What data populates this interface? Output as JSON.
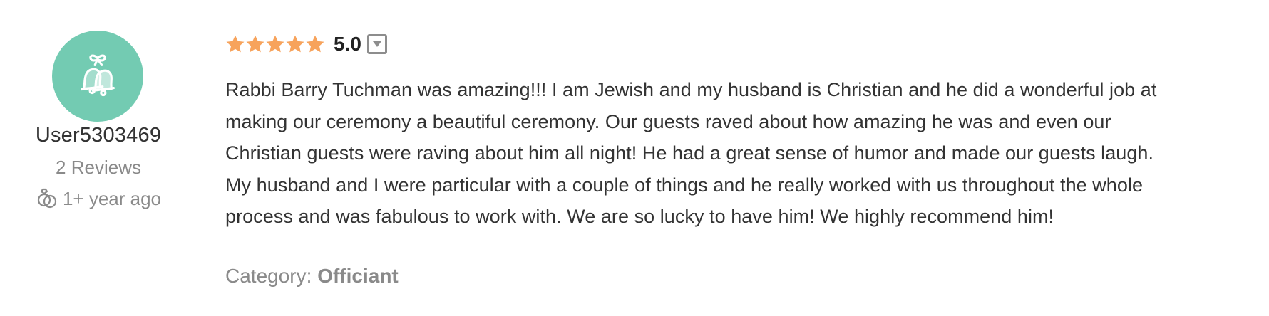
{
  "author": {
    "username": "User5303469",
    "reviews": "2 Reviews",
    "date": "1+ year ago",
    "avatar_icon": "wedding-bells-icon",
    "date_icon": "wedding-rings-icon",
    "avatar_color": "#73cbb2"
  },
  "rating": {
    "value": "5.0",
    "stars": 5,
    "max_stars": 5,
    "star_color": "#f7a35c",
    "toggle_icon": "dropdown-toggle-icon"
  },
  "review": {
    "lines": [
      "Rabbi Barry Tuchman was amazing!!! I am Jewish and my husband is Christian and he did a wonderful job at",
      "making our ceremony a beautiful ceremony. Our guests raved about how amazing he was and even our",
      "Christian guests were raving about him all night! He had a great sense of humor and made our guests laugh.",
      "My husband and I were particular with a couple of things and he really worked with us throughout the whole",
      "process and was fabulous to work with. We are so lucky to have him! We highly recommend him!"
    ]
  },
  "category": {
    "label": "Category:",
    "value": "Officiant"
  }
}
